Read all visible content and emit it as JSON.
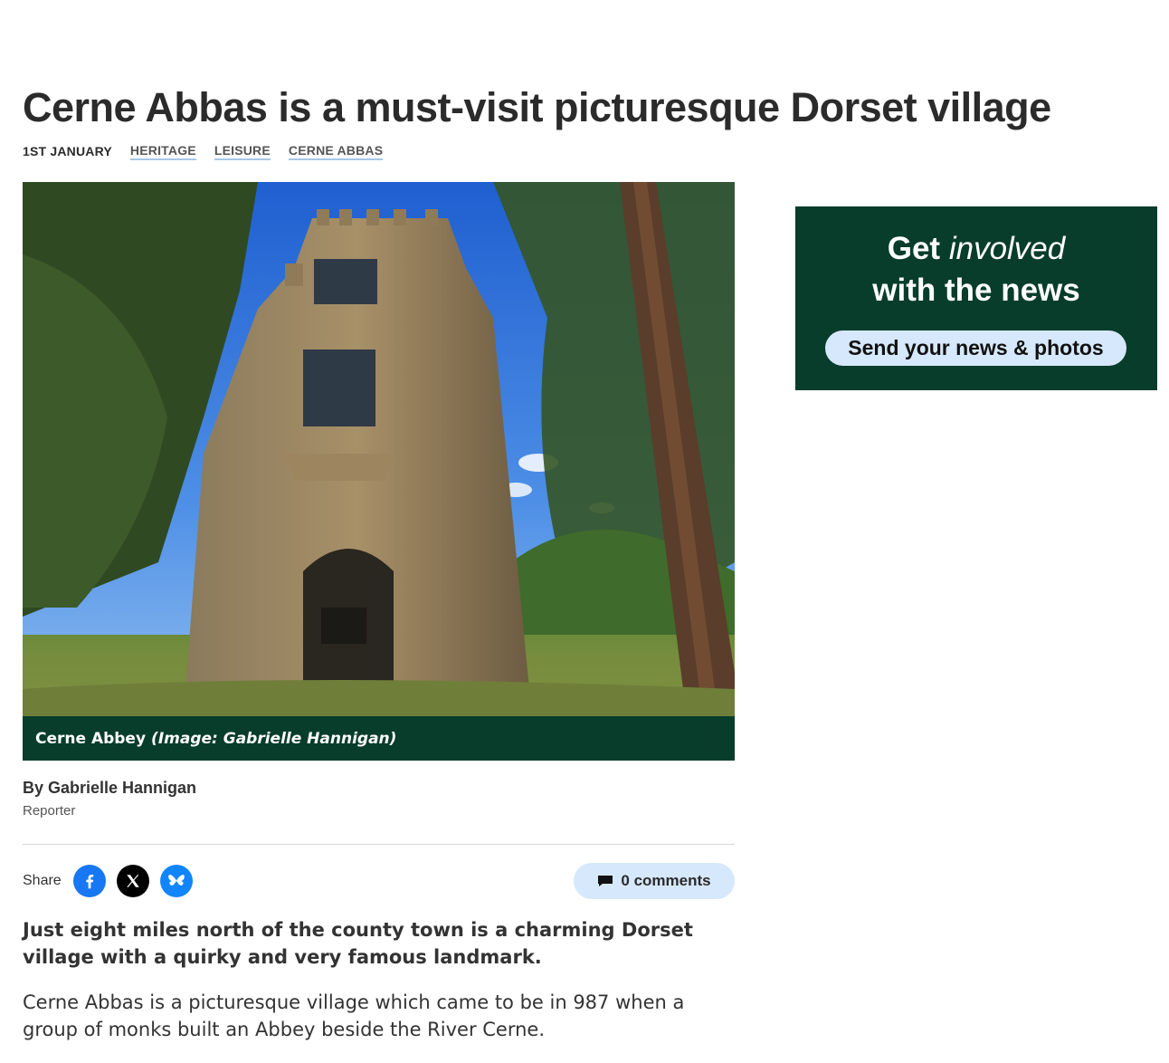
{
  "article": {
    "headline": "Cerne Abbas is a must-visit picturesque Dorset village",
    "date": "1ST JANUARY",
    "tags": [
      "HERITAGE",
      "LEISURE",
      "CERNE ABBAS"
    ],
    "image": {
      "caption": "Cerne Abbey",
      "credit": "(Image: Gabrielle Hannigan)"
    },
    "byline": {
      "author": "By Gabrielle Hannigan",
      "role": "Reporter"
    },
    "share": {
      "label": "Share",
      "networks": [
        "facebook-icon",
        "x-icon",
        "bluesky-icon"
      ]
    },
    "comments": {
      "label": "0 comments"
    },
    "standfirst": "Just eight miles north of the county town is a charming Dorset village with a quirky and very famous landmark.",
    "paragraphs": [
      "Cerne Abbas is a picturesque village which came to be in 987 when a group of monks built an Abbey beside the River Cerne."
    ]
  },
  "promo": {
    "line1_bold": "Get",
    "line1_italic": "involved",
    "line2": "with the news",
    "cta": "Send your news & photos"
  },
  "colors": {
    "brand_green": "#083d2b",
    "accent_light_blue": "#d6e8fb",
    "tag_underline": "#a9c7e8",
    "facebook": "#1877f2",
    "x": "#000000",
    "bluesky": "#1185fe"
  }
}
